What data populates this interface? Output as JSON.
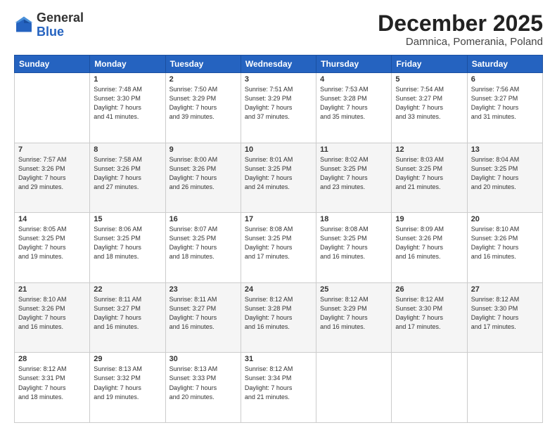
{
  "header": {
    "logo_general": "General",
    "logo_blue": "Blue",
    "month": "December 2025",
    "location": "Damnica, Pomerania, Poland"
  },
  "weekdays": [
    "Sunday",
    "Monday",
    "Tuesday",
    "Wednesday",
    "Thursday",
    "Friday",
    "Saturday"
  ],
  "weeks": [
    [
      {
        "day": "",
        "info": ""
      },
      {
        "day": "1",
        "info": "Sunrise: 7:48 AM\nSunset: 3:30 PM\nDaylight: 7 hours\nand 41 minutes."
      },
      {
        "day": "2",
        "info": "Sunrise: 7:50 AM\nSunset: 3:29 PM\nDaylight: 7 hours\nand 39 minutes."
      },
      {
        "day": "3",
        "info": "Sunrise: 7:51 AM\nSunset: 3:29 PM\nDaylight: 7 hours\nand 37 minutes."
      },
      {
        "day": "4",
        "info": "Sunrise: 7:53 AM\nSunset: 3:28 PM\nDaylight: 7 hours\nand 35 minutes."
      },
      {
        "day": "5",
        "info": "Sunrise: 7:54 AM\nSunset: 3:27 PM\nDaylight: 7 hours\nand 33 minutes."
      },
      {
        "day": "6",
        "info": "Sunrise: 7:56 AM\nSunset: 3:27 PM\nDaylight: 7 hours\nand 31 minutes."
      }
    ],
    [
      {
        "day": "7",
        "info": "Sunrise: 7:57 AM\nSunset: 3:26 PM\nDaylight: 7 hours\nand 29 minutes."
      },
      {
        "day": "8",
        "info": "Sunrise: 7:58 AM\nSunset: 3:26 PM\nDaylight: 7 hours\nand 27 minutes."
      },
      {
        "day": "9",
        "info": "Sunrise: 8:00 AM\nSunset: 3:26 PM\nDaylight: 7 hours\nand 26 minutes."
      },
      {
        "day": "10",
        "info": "Sunrise: 8:01 AM\nSunset: 3:25 PM\nDaylight: 7 hours\nand 24 minutes."
      },
      {
        "day": "11",
        "info": "Sunrise: 8:02 AM\nSunset: 3:25 PM\nDaylight: 7 hours\nand 23 minutes."
      },
      {
        "day": "12",
        "info": "Sunrise: 8:03 AM\nSunset: 3:25 PM\nDaylight: 7 hours\nand 21 minutes."
      },
      {
        "day": "13",
        "info": "Sunrise: 8:04 AM\nSunset: 3:25 PM\nDaylight: 7 hours\nand 20 minutes."
      }
    ],
    [
      {
        "day": "14",
        "info": "Sunrise: 8:05 AM\nSunset: 3:25 PM\nDaylight: 7 hours\nand 19 minutes."
      },
      {
        "day": "15",
        "info": "Sunrise: 8:06 AM\nSunset: 3:25 PM\nDaylight: 7 hours\nand 18 minutes."
      },
      {
        "day": "16",
        "info": "Sunrise: 8:07 AM\nSunset: 3:25 PM\nDaylight: 7 hours\nand 18 minutes."
      },
      {
        "day": "17",
        "info": "Sunrise: 8:08 AM\nSunset: 3:25 PM\nDaylight: 7 hours\nand 17 minutes."
      },
      {
        "day": "18",
        "info": "Sunrise: 8:08 AM\nSunset: 3:25 PM\nDaylight: 7 hours\nand 16 minutes."
      },
      {
        "day": "19",
        "info": "Sunrise: 8:09 AM\nSunset: 3:26 PM\nDaylight: 7 hours\nand 16 minutes."
      },
      {
        "day": "20",
        "info": "Sunrise: 8:10 AM\nSunset: 3:26 PM\nDaylight: 7 hours\nand 16 minutes."
      }
    ],
    [
      {
        "day": "21",
        "info": "Sunrise: 8:10 AM\nSunset: 3:26 PM\nDaylight: 7 hours\nand 16 minutes."
      },
      {
        "day": "22",
        "info": "Sunrise: 8:11 AM\nSunset: 3:27 PM\nDaylight: 7 hours\nand 16 minutes."
      },
      {
        "day": "23",
        "info": "Sunrise: 8:11 AM\nSunset: 3:27 PM\nDaylight: 7 hours\nand 16 minutes."
      },
      {
        "day": "24",
        "info": "Sunrise: 8:12 AM\nSunset: 3:28 PM\nDaylight: 7 hours\nand 16 minutes."
      },
      {
        "day": "25",
        "info": "Sunrise: 8:12 AM\nSunset: 3:29 PM\nDaylight: 7 hours\nand 16 minutes."
      },
      {
        "day": "26",
        "info": "Sunrise: 8:12 AM\nSunset: 3:30 PM\nDaylight: 7 hours\nand 17 minutes."
      },
      {
        "day": "27",
        "info": "Sunrise: 8:12 AM\nSunset: 3:30 PM\nDaylight: 7 hours\nand 17 minutes."
      }
    ],
    [
      {
        "day": "28",
        "info": "Sunrise: 8:12 AM\nSunset: 3:31 PM\nDaylight: 7 hours\nand 18 minutes."
      },
      {
        "day": "29",
        "info": "Sunrise: 8:13 AM\nSunset: 3:32 PM\nDaylight: 7 hours\nand 19 minutes."
      },
      {
        "day": "30",
        "info": "Sunrise: 8:13 AM\nSunset: 3:33 PM\nDaylight: 7 hours\nand 20 minutes."
      },
      {
        "day": "31",
        "info": "Sunrise: 8:12 AM\nSunset: 3:34 PM\nDaylight: 7 hours\nand 21 minutes."
      },
      {
        "day": "",
        "info": ""
      },
      {
        "day": "",
        "info": ""
      },
      {
        "day": "",
        "info": ""
      }
    ]
  ]
}
